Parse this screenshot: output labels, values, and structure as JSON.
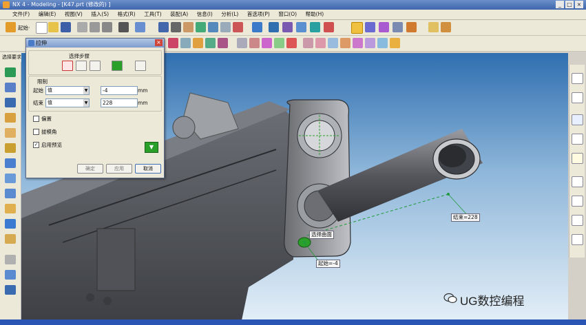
{
  "window": {
    "title": "NX 4 - Modeling - [K47.prt (修改的) ]",
    "buttons": [
      "_",
      "□",
      "×"
    ]
  },
  "menu": [
    "文件(F)",
    "编辑(E)",
    "视图(V)",
    "插入(S)",
    "格式(R)",
    "工具(T)",
    "装配(A)",
    "信息(I)",
    "分析(L)",
    "首选项(P)",
    "窗口(O)",
    "帮助(H)"
  ],
  "toolbar": {
    "start_label": "起始·"
  },
  "filter_label": "选择要求",
  "dialog": {
    "title": "拉伸",
    "selection_steps_label": "选择步骤",
    "limits_label": "限制",
    "start_label": "起始",
    "start_mode": "值",
    "start_value": "-4",
    "end_label": "结束",
    "end_mode": "值",
    "end_value": "228",
    "unit": "mm",
    "offset_label": "偏置",
    "draft_label": "拔模角",
    "preview_label": "启用预览",
    "preview_checked": "✓",
    "ok_label": "确定",
    "apply_label": "应用",
    "cancel_label": "取消"
  },
  "viewport": {
    "end_callout": "结束=228",
    "start_callout": "起始=-4",
    "select_curve_callout": "选择曲面"
  },
  "watermark": "UG数控编程",
  "colors": {
    "accent": "#3f66ad",
    "preview_green": "#2aa02a",
    "model": "#5a5c60"
  }
}
